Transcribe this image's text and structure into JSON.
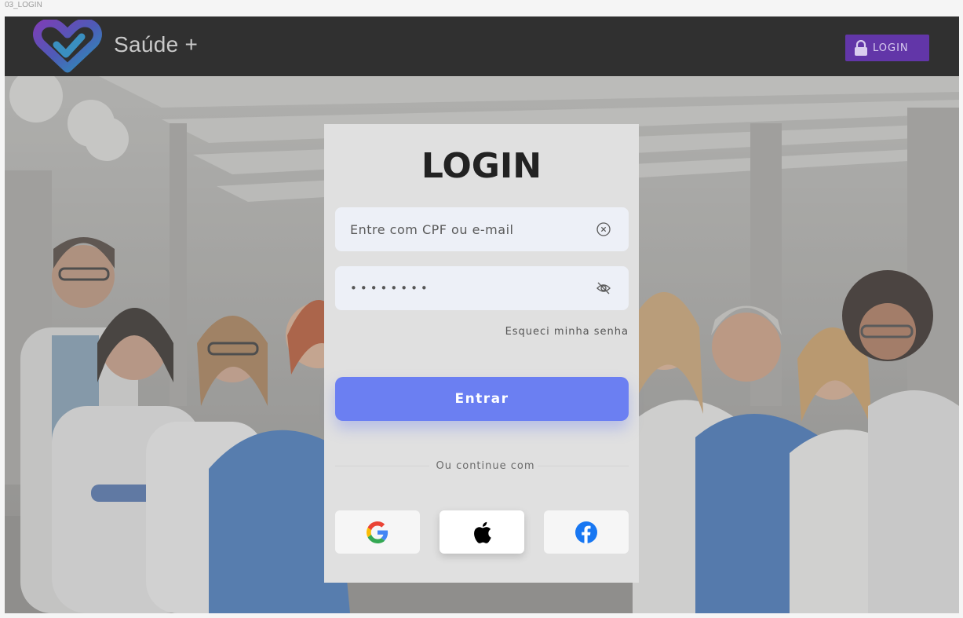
{
  "frame_label": "03_LOGIN",
  "header": {
    "brand": "Saúde +",
    "login_button": "LOGIN"
  },
  "card": {
    "title": "LOGIN",
    "email_placeholder": "Entre com CPF ou e-mail",
    "password_value": "••••••••",
    "forgot_password": "Esqueci minha senha",
    "submit_label": "Entrar",
    "divider_text": "Ou continue com"
  },
  "icons": {
    "logo": "heart-logo-icon",
    "lock": "lock-icon",
    "clear": "clear-circle-icon",
    "eye": "eye-off-icon",
    "google": "google-icon",
    "apple": "apple-icon",
    "facebook": "facebook-icon"
  },
  "colors": {
    "header_bg": "#303030",
    "accent_purple": "#6236a8",
    "primary_button": "#6b7ff2",
    "card_bg": "#e0e0e0",
    "field_bg": "#edf0f7"
  }
}
